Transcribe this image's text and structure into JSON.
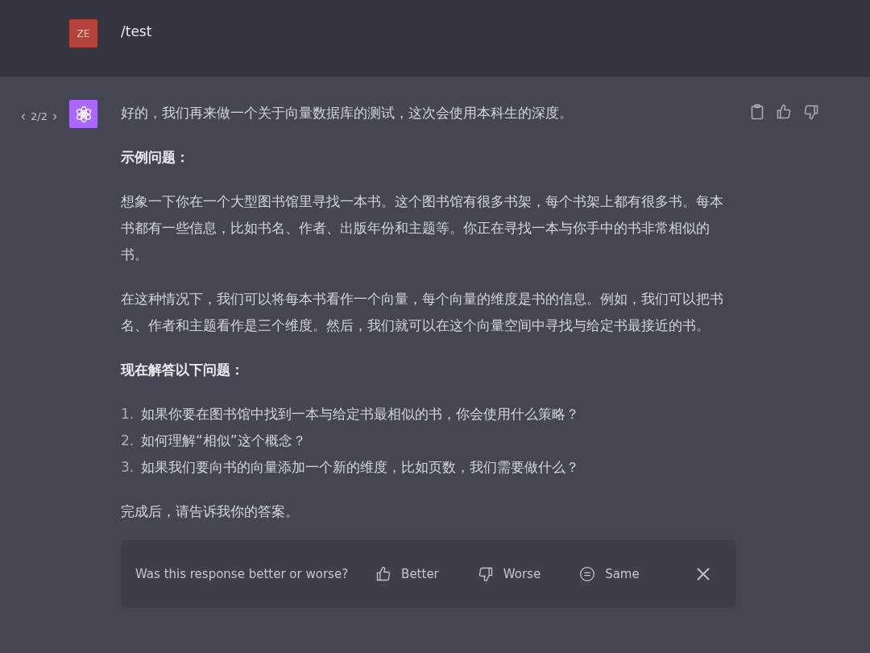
{
  "user_message": {
    "avatar": "ZE",
    "text": "/test"
  },
  "assistant_message": {
    "pager": "2/2",
    "blocks": [
      {
        "kind": "paragraph",
        "text": "好的，我们再来做一个关于向量数据库的测试，这次会使用本科生的深度。"
      },
      {
        "kind": "heading",
        "text": "示例问题："
      },
      {
        "kind": "paragraph",
        "text": "想象一下你在一个大型图书馆里寻找一本书。这个图书馆有很多书架，每个书架上都有很多书。每本书都有一些信息，比如书名、作者、出版年份和主题等。你正在寻找一本与你手中的书非常相似的书。"
      },
      {
        "kind": "paragraph",
        "text": "在这种情况下，我们可以将每本书看作一个向量，每个向量的维度是书的信息。例如，我们可以把书名、作者和主题看作是三个维度。然后，我们就可以在这个向量空间中寻找与给定书最接近的书。"
      },
      {
        "kind": "heading",
        "text": "现在解答以下问题："
      },
      {
        "kind": "list",
        "items": [
          {
            "number": "1.",
            "text": "如果你要在图书馆中找到一本与给定书最相似的书，你会使用什么策略？"
          },
          {
            "number": "2.",
            "text": "如何理解“相似”这个概念？"
          },
          {
            "number": "3.",
            "text": "如果我们要向书的向量添加一个新的维度，比如页数，我们需要做什么？"
          }
        ]
      },
      {
        "kind": "paragraph",
        "text": "完成后，请告诉我你的答案。"
      }
    ]
  },
  "feedback": {
    "question": "Was this response better or worse?",
    "options": [
      {
        "kind": "better",
        "label": "Better"
      },
      {
        "kind": "worse",
        "label": "Worse"
      },
      {
        "kind": "same",
        "label": "Same"
      }
    ]
  }
}
